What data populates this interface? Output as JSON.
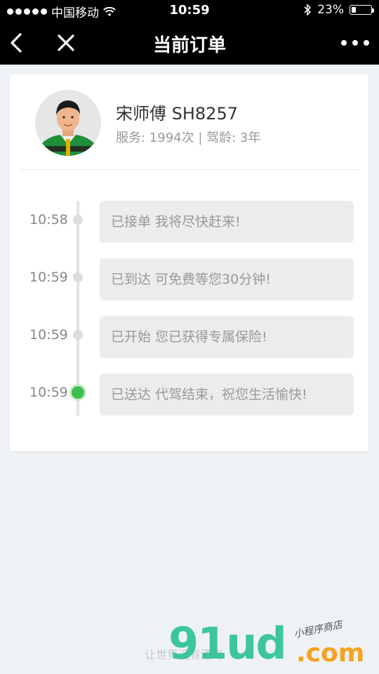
{
  "status_bar": {
    "carrier": "中国移动",
    "time": "10:59",
    "battery": "23%",
    "battery_level": 0.23,
    "signal_bars": 5
  },
  "nav": {
    "title": "当前订单",
    "icons": [
      "back-arrow-icon",
      "close-icon",
      "more-icon"
    ]
  },
  "driver": {
    "name": "宋师傅 SH8257",
    "meta": "服务: 1994次 | 驾龄: 3年"
  },
  "timeline": [
    {
      "time": "10:58",
      "text": "已接单 我将尽快赶来!",
      "active": false
    },
    {
      "time": "10:59",
      "text": "已到达 可免费等您30分钟!",
      "active": false
    },
    {
      "time": "10:59",
      "text": "已开始 您已获得专属保险!",
      "active": false
    },
    {
      "time": "10:59",
      "text": "已送达 代驾结束，祝您生活愉快!",
      "active": true
    }
  ],
  "footer": {
    "slogan": "让世界没有酒驾"
  },
  "watermark": {
    "logo": "91ud",
    "domain": ".com",
    "tag": "小程序商店"
  },
  "colors": {
    "accent_green": "#3bbf4e",
    "bar_background": "#000000",
    "page_background": "#eff2f5"
  }
}
